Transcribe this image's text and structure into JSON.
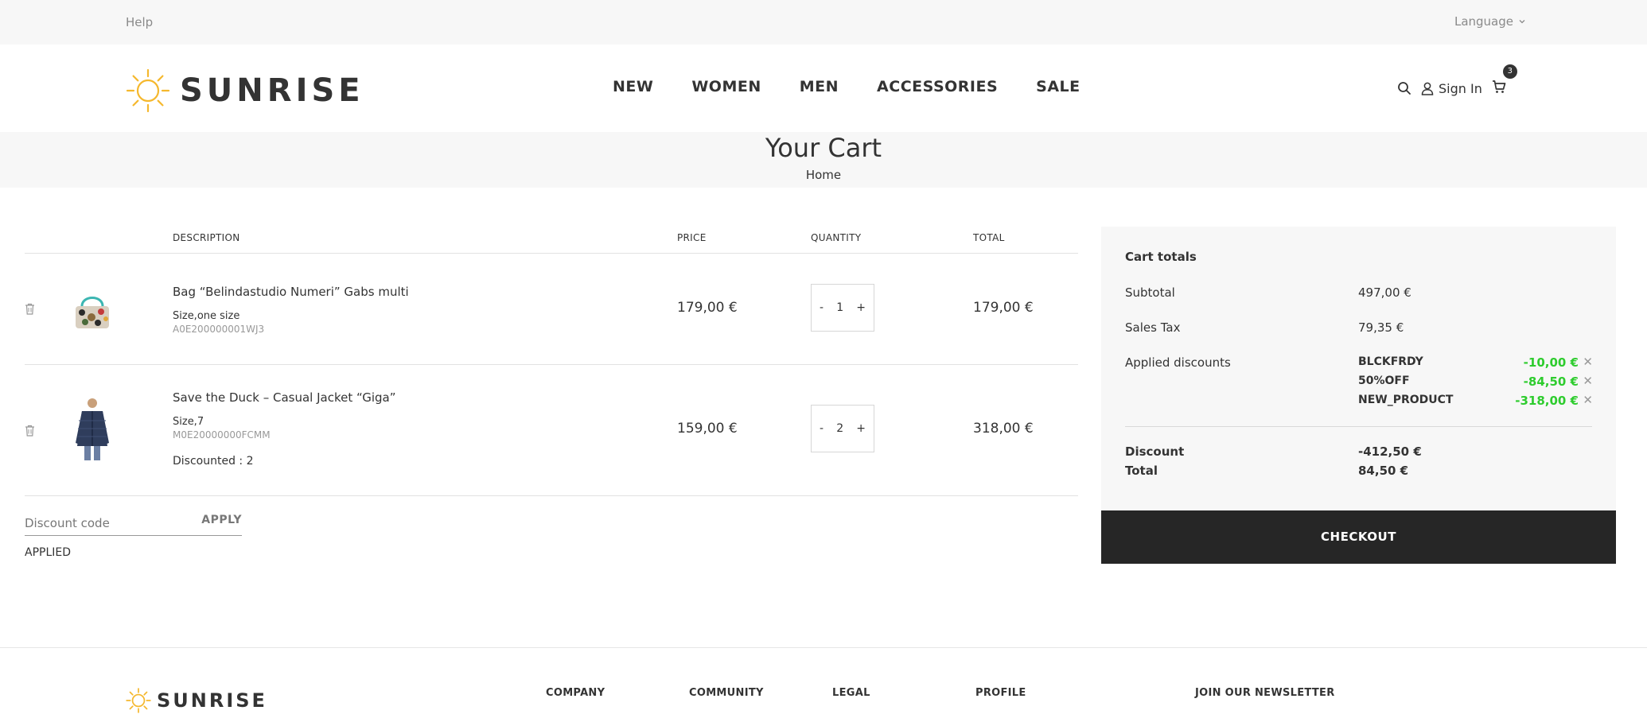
{
  "topbar": {
    "help": "Help",
    "language": "Language"
  },
  "brand": {
    "name": "SUNRISE",
    "accent": "#f5b82e"
  },
  "nav": [
    "NEW",
    "WOMEN",
    "MEN",
    "ACCESSORIES",
    "SALE"
  ],
  "header": {
    "sign_in": "Sign In",
    "cart_count": "3"
  },
  "page": {
    "title": "Your Cart",
    "breadcrumb": "Home"
  },
  "table": {
    "headers": [
      "DESCRIPTION",
      "PRICE",
      "QUANTITY",
      "TOTAL"
    ],
    "items": [
      {
        "name": "Bag “Belindastudio Numeri” Gabs multi",
        "size": "Size,one size",
        "sku": "A0E200000001WJ3",
        "price": "179,00 €",
        "qty": "1",
        "total": "179,00 €",
        "qty_minus": "-",
        "qty_plus": "+"
      },
      {
        "name": "Save the Duck – Casual Jacket “Giga”",
        "size": "Size,7",
        "sku": "M0E20000000FCMM",
        "discounted": "Discounted : 2",
        "price": "159,00 €",
        "qty": "2",
        "total": "318,00 €",
        "qty_minus": "-",
        "qty_plus": "+"
      }
    ]
  },
  "discount_form": {
    "placeholder": "Discount code",
    "apply": "APPLY",
    "status": "APPLIED"
  },
  "totals": {
    "title": "Cart totals",
    "subtotal_label": "Subtotal",
    "subtotal": "497,00 €",
    "tax_label": "Sales Tax",
    "tax": "79,35 €",
    "discounts_label": "Applied discounts",
    "discounts": [
      {
        "code": "BLCKFRDY",
        "amount": "-10,00 €"
      },
      {
        "code": "50%OFF",
        "amount": "-84,50 €"
      },
      {
        "code": "NEW_PRODUCT",
        "amount": "-318,00 €"
      }
    ],
    "discount_label": "Discount",
    "discount": "-412,50 €",
    "total_label": "Total",
    "total": "84,50 €",
    "discount_color": "#2ecc2e"
  },
  "checkout": "CHECKOUT",
  "footer": {
    "columns": [
      "COMPANY",
      "COMMUNITY",
      "LEGAL",
      "PROFILE",
      "JOIN OUR NEWSLETTER"
    ]
  }
}
